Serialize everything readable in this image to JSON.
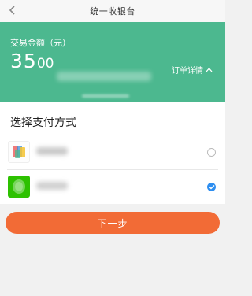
{
  "header": {
    "title": "统一收银台",
    "back_icon": "chevron-left-icon"
  },
  "card": {
    "amount_label": "交易金额（元）",
    "amount_integer": "35",
    "amount_decimal": "00",
    "detail_label": "订单详情",
    "detail_icon": "chevron-up-icon",
    "background_color": "#4cb88f"
  },
  "payment": {
    "section_title": "选择支付方式",
    "methods": [
      {
        "icon": "unionpay-icon",
        "selected": false
      },
      {
        "icon": "wechat-pay-icon",
        "selected": true
      }
    ]
  },
  "footer": {
    "next_label": "下一步",
    "button_color": "#f26b36"
  }
}
